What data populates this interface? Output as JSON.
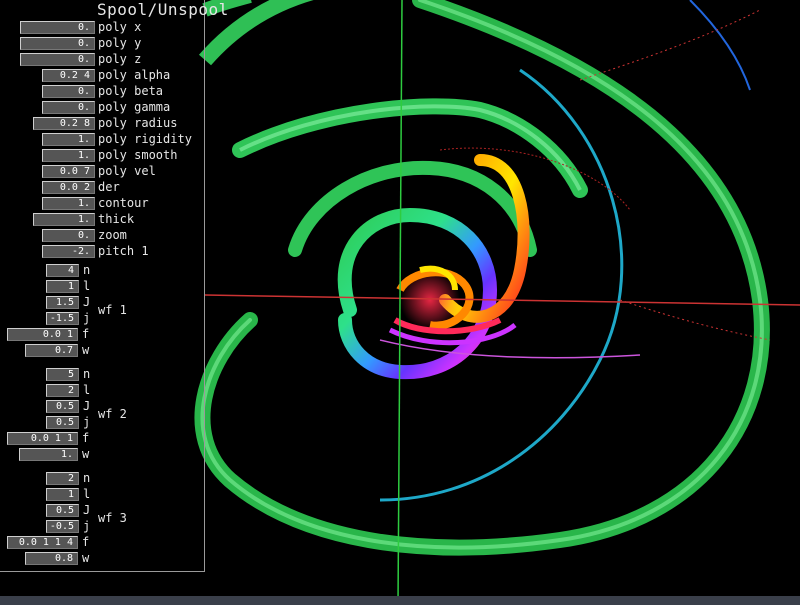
{
  "panel": {
    "title": "Spool/Unspool",
    "params": [
      {
        "value": "0.",
        "label": "poly x"
      },
      {
        "value": "0.",
        "label": "poly y"
      },
      {
        "value": "0.",
        "label": "poly z"
      },
      {
        "value": "0.2 4",
        "label": "poly alpha"
      },
      {
        "value": "0.",
        "label": "poly beta"
      },
      {
        "value": "0.",
        "label": "poly gamma"
      },
      {
        "value": "0.2 8",
        "label": "poly radius"
      },
      {
        "value": "1.",
        "label": "poly rigidity"
      },
      {
        "value": "1.",
        "label": "poly smooth"
      },
      {
        "value": "0.0 7",
        "label": "poly vel"
      },
      {
        "value": "0.0 2",
        "label": "der"
      },
      {
        "value": "1.",
        "label": "contour"
      },
      {
        "value": "1.",
        "label": "thick"
      },
      {
        "value": "0.",
        "label": "zoom"
      },
      {
        "value": "-2.",
        "label": "pitch 1"
      }
    ],
    "wavefunctions": [
      {
        "name": "wf 1",
        "fields": [
          {
            "value": "4",
            "label": "n"
          },
          {
            "value": "1",
            "label": "l"
          },
          {
            "value": "1.5",
            "label": "J"
          },
          {
            "value": "-1.5",
            "label": "j"
          },
          {
            "value": "0.0 1",
            "label": "f"
          },
          {
            "value": "0.7",
            "label": "w"
          }
        ]
      },
      {
        "name": "wf 2",
        "fields": [
          {
            "value": "5",
            "label": "n"
          },
          {
            "value": "2",
            "label": "l"
          },
          {
            "value": "0.5",
            "label": "J"
          },
          {
            "value": "0.5",
            "label": "j"
          },
          {
            "value": "0.0 1 1",
            "label": "f"
          },
          {
            "value": "1.",
            "label": "w"
          }
        ]
      },
      {
        "name": "wf 3",
        "fields": [
          {
            "value": "2",
            "label": "n"
          },
          {
            "value": "1",
            "label": "l"
          },
          {
            "value": "0.5",
            "label": "J"
          },
          {
            "value": "-0.5",
            "label": "j"
          },
          {
            "value": "0.0 1 1 4",
            "label": "f"
          },
          {
            "value": "0.8",
            "label": "w"
          }
        ]
      }
    ]
  }
}
